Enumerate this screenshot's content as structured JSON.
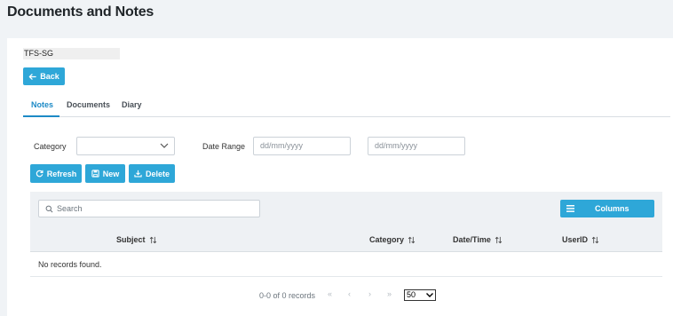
{
  "page": {
    "title": "Documents and Notes"
  },
  "entity": {
    "tag": "TFS-SG"
  },
  "back_button": {
    "label": "Back"
  },
  "tabs": [
    {
      "label": "Notes",
      "active": true
    },
    {
      "label": "Documents",
      "active": false
    },
    {
      "label": "Diary",
      "active": false
    }
  ],
  "filters": {
    "category_label": "Category",
    "category_value": "",
    "date_range_label": "Date Range",
    "date_from_placeholder": "dd/mm/yyyy",
    "date_to_placeholder": "dd/mm/yyyy"
  },
  "actions": {
    "refresh_label": "Refresh",
    "new_label": "New",
    "delete_label": "Delete"
  },
  "grid": {
    "search_placeholder": "Search",
    "columns_button_label": "Columns",
    "headers": [
      "Subject",
      "Category",
      "Date/Time",
      "UserID"
    ],
    "empty_message": "No records found."
  },
  "paginator": {
    "report": "0-0 of 0 records",
    "first": "«",
    "prev": "‹",
    "next": "›",
    "last": "»",
    "rows_per_page": "50"
  },
  "colors": {
    "accent": "#2ea7d8",
    "active_tab": "#1d8ac6",
    "toolbar_bg": "#eef1f4"
  },
  "icons": {
    "back": "arrow-left-icon",
    "refresh": "refresh-icon",
    "new": "save-icon",
    "delete": "download-icon",
    "search": "search-icon",
    "columns": "list-icon",
    "sort": "sort-icon",
    "dropdown": "chevron-down-icon"
  }
}
